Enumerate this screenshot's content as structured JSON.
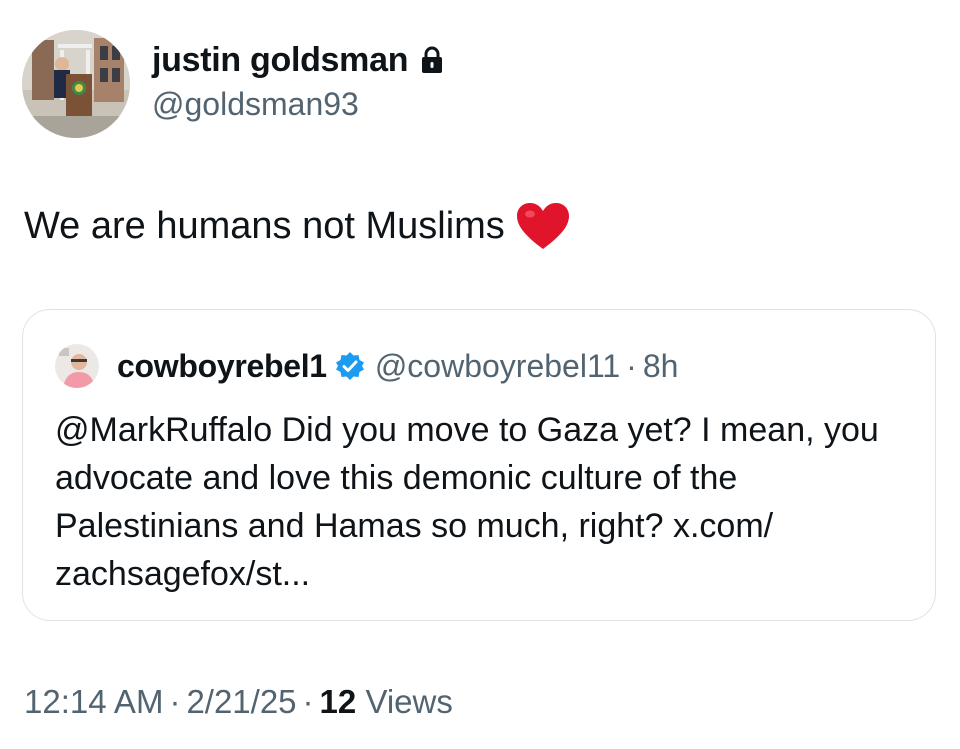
{
  "author": {
    "display_name": "justin goldsman",
    "handle": "@goldsman93",
    "protected_icon": "lock-icon"
  },
  "tweet": {
    "text": "We are humans not Muslims",
    "emoji_icon": "red-heart-icon"
  },
  "quote": {
    "display_name": "cowboyrebel1",
    "verified_icon": "verified-badge-icon",
    "handle": "@cowboyrebel11",
    "separator": "·",
    "time": "8h",
    "body": "@MarkRuffalo Did you move to Gaza yet? I mean, you advocate and love this demonic culture of the Palestinians and Hamas so much, right? x.com/ zachsagefox/st..."
  },
  "meta": {
    "time": "12:14 AM",
    "date": "2/21/25",
    "separator": "·",
    "views_count": "12",
    "views_label": "Views"
  },
  "colors": {
    "text_primary": "#0f1419",
    "text_secondary": "#536471",
    "border": "#dfe3e6",
    "verified_blue": "#1d9bf0",
    "heart_red": "#e0142b"
  }
}
